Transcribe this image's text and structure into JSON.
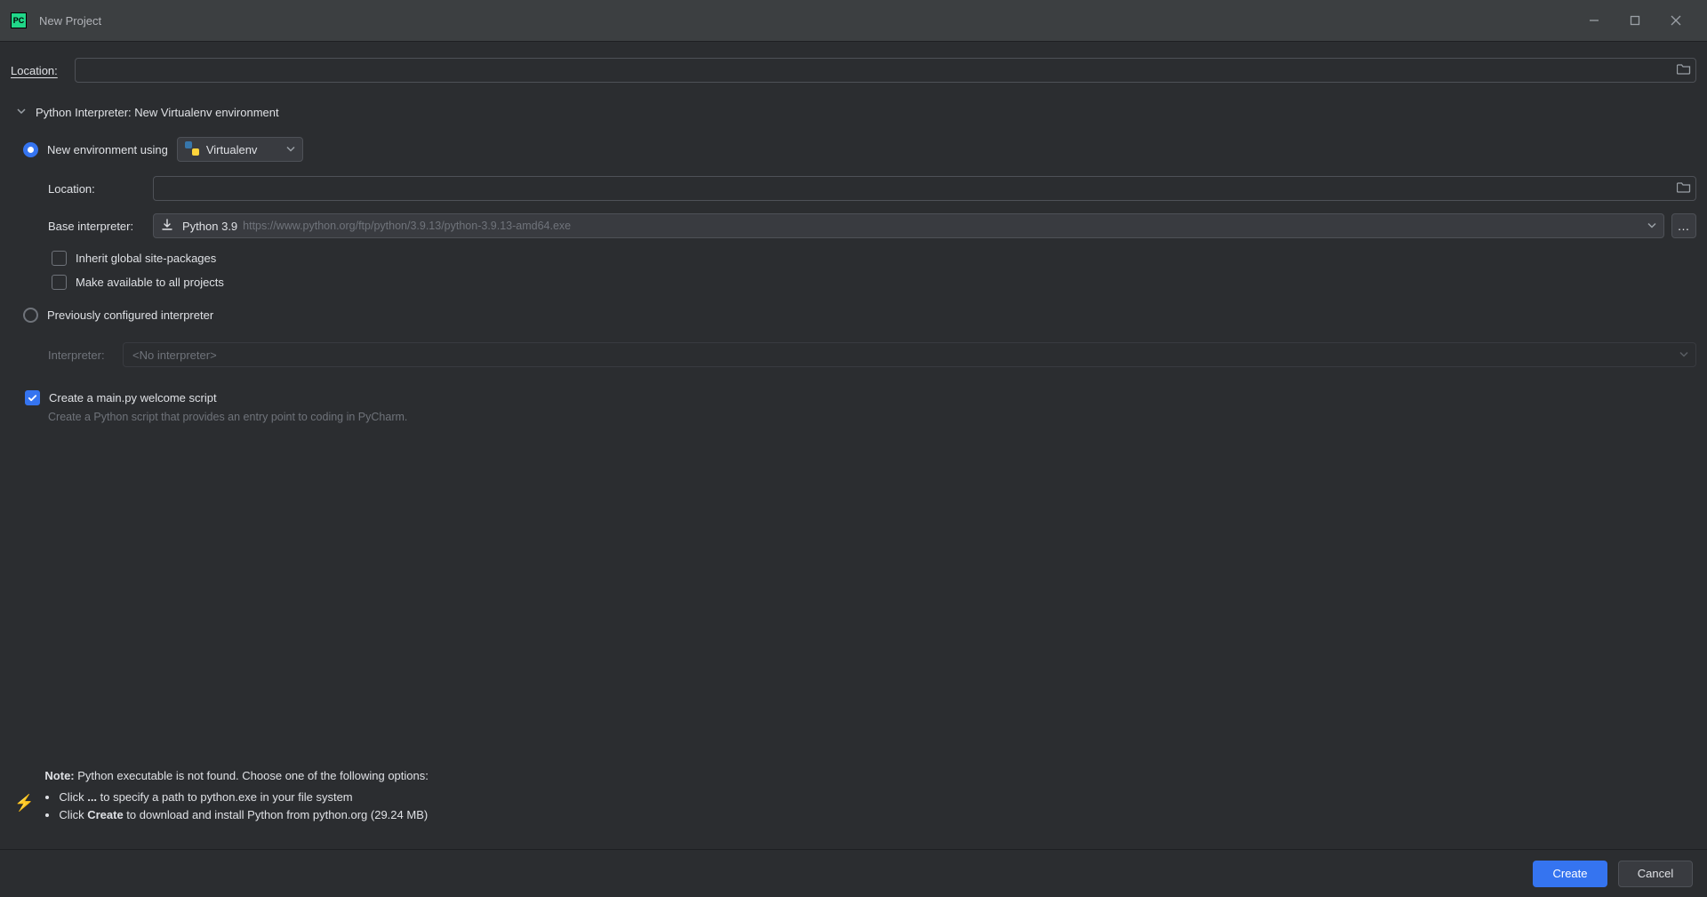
{
  "window": {
    "title": "New Project"
  },
  "location": {
    "label": "Location:",
    "value": ""
  },
  "interpreter_section": {
    "header": "Python Interpreter: New Virtualenv environment"
  },
  "new_env": {
    "radio_label": "New environment using",
    "env_tool": "Virtualenv",
    "location_label": "Location:",
    "location_value": "",
    "base_label": "Base interpreter:",
    "base_value": "Python 3.9",
    "base_hint": "https://www.python.org/ftp/python/3.9.13/python-3.9.13-amd64.exe",
    "inherit_label": "Inherit global site-packages",
    "make_avail_label": "Make available to all projects"
  },
  "prev_env": {
    "radio_label": "Previously configured interpreter",
    "interp_label": "Interpreter:",
    "interp_value": "<No interpreter>"
  },
  "welcome": {
    "check_label": "Create a main.py welcome script",
    "desc": "Create a Python script that provides an entry point to coding in PyCharm."
  },
  "note": {
    "prefix": "Note:",
    "text": " Python executable is not found. Choose one of the following options:",
    "bullet1_a": "Click ",
    "bullet1_b": "...",
    "bullet1_c": " to specify a path to python.exe in your file system",
    "bullet2_a": "Click ",
    "bullet2_b": "Create",
    "bullet2_c": " to download and install Python from python.org (29.24 MB)"
  },
  "footer": {
    "create": "Create",
    "cancel": "Cancel"
  }
}
